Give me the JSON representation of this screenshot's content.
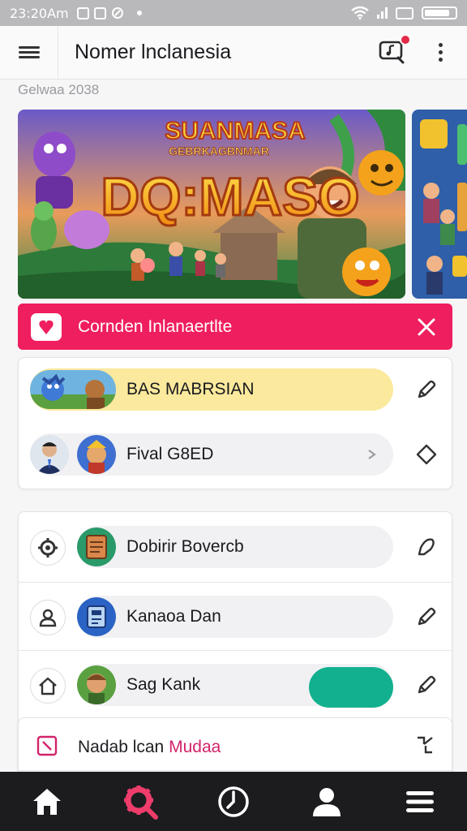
{
  "status": {
    "time": "23:20Am"
  },
  "appbar": {
    "title": "Nomer lnclanesia"
  },
  "subheading": "Gelwaa 2038",
  "banner": {
    "subtitle_top": "SUANMASA",
    "subtitle_small": "GEBRKAGBNMAR",
    "headline": "DQ:MASO"
  },
  "promo": {
    "label": "Cornden Inlanaertlte"
  },
  "rows_top": [
    {
      "label": "BAS MABRSIAN",
      "highlight": "#fbe99d"
    },
    {
      "label": "Fival G8ED"
    }
  ],
  "rows_bottom": [
    {
      "label": "Dobirir Bovercb"
    },
    {
      "label": "Kanaoa Dan"
    },
    {
      "label": "Sag Kank",
      "toggle_color": "#12b08f"
    }
  ],
  "footer_item": {
    "label_plain": "Nadab lcan",
    "label_accent": "Mudaa",
    "accent_color": "#d1246a"
  },
  "nav": [
    {
      "icon": "home-icon"
    },
    {
      "icon": "gear-search-icon",
      "active": true,
      "color": "#ef3d6b"
    },
    {
      "icon": "clock-icon"
    },
    {
      "icon": "person-icon"
    },
    {
      "icon": "menu-icon"
    }
  ]
}
